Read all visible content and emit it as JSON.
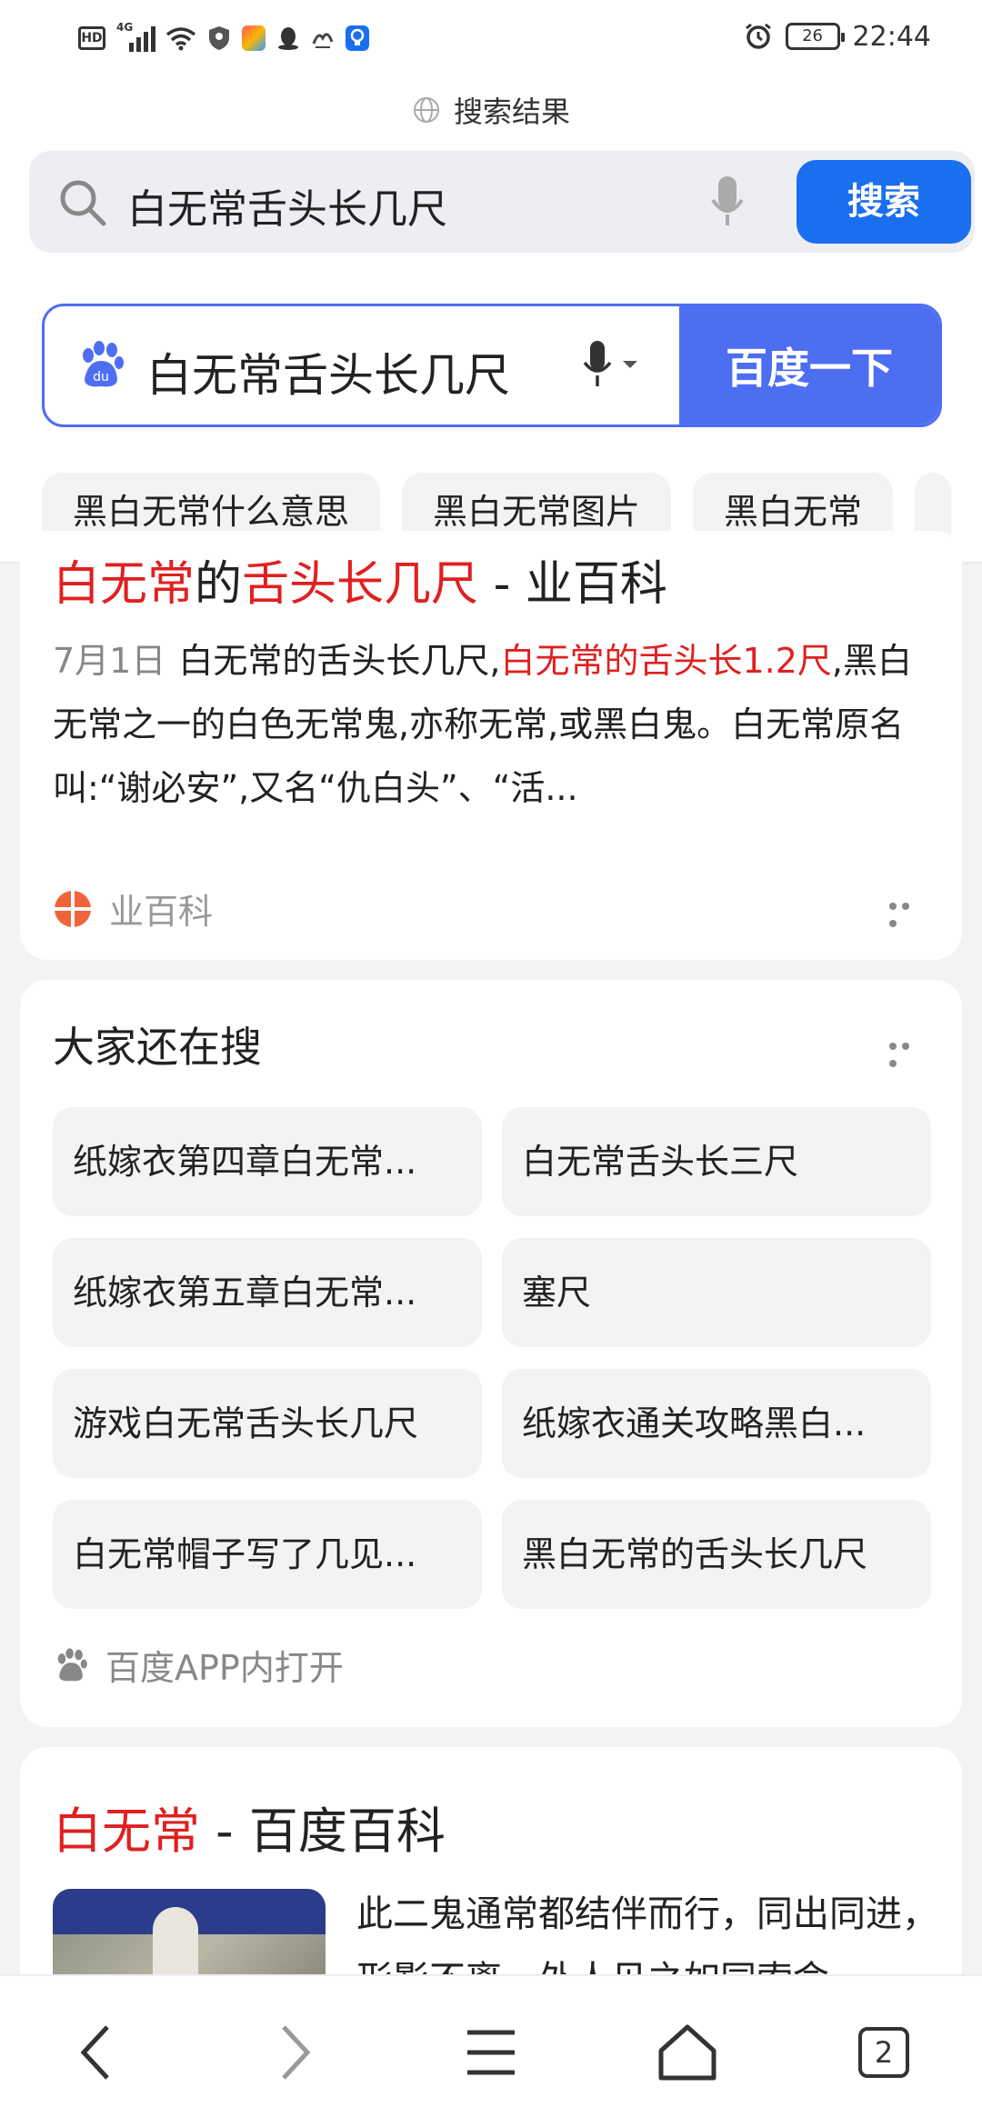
{
  "status_bar": {
    "hd_label": "HD",
    "network_label": "4G",
    "battery": "26",
    "time": "22:44"
  },
  "browser": {
    "page_caption": "搜索结果",
    "query": "白无常舌头长几尺",
    "search_button": "搜索",
    "tab_count": "2"
  },
  "baidu": {
    "query": "白无常舌头长几尺",
    "search_button": "百度一下",
    "chips": [
      "黑白无常什么意思",
      "黑白无常图片",
      "黑白无常"
    ]
  },
  "result1": {
    "title_red_1": "白无常",
    "title_mid": "的",
    "title_red_2": "舌头长几尺",
    "title_tail": " - 业百科",
    "date": "7月1日",
    "text_a": "白无常的舌头长几尺,",
    "text_red": "白无常的舌头长1.2尺",
    "text_b": ",黑白无常之一的白色无常鬼,亦称无常,或黑白鬼。白无常原名叫:“谢必安”,又名“仇白头”、“活...",
    "source": "业百科"
  },
  "related": {
    "title": "大家还在搜",
    "items": [
      "纸嫁衣第四章白无常...",
      "白无常舌头长三尺",
      "纸嫁衣第五章白无常...",
      "塞尺",
      "游戏白无常舌头长几尺",
      "纸嫁衣通关攻略黑白...",
      "白无常帽子写了几见...",
      "黑白无常的舌头长几尺"
    ],
    "open_in_app": "百度APP内打开"
  },
  "result3": {
    "title_red": "白无常",
    "title_tail": " - 百度百科",
    "text": "此二鬼通常都结伴而行，同出同进，形影不离。外人见之如同索命"
  },
  "colors": {
    "baidu_blue": "#4e6ef2",
    "browser_blue": "#1a6ef0",
    "highlight_red": "#e02020"
  }
}
